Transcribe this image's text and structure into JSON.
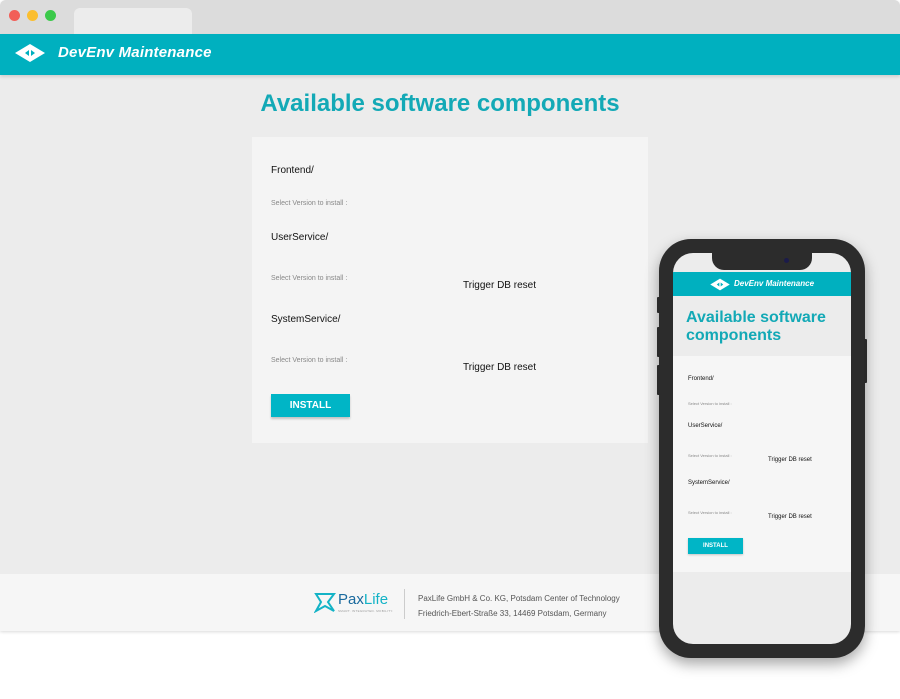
{
  "browser": {
    "tab_title": ""
  },
  "app": {
    "title": "DevEnv Maintenance",
    "logo_icon": "diamond-arrows-icon"
  },
  "page": {
    "heading": "Available software components"
  },
  "components": [
    {
      "name": "Frontend/",
      "hint": "Select Version to install :"
    },
    {
      "name": "UserService/",
      "hint": "Select Version to install :",
      "reset_label": "Trigger DB reset"
    },
    {
      "name": "SystemService/",
      "hint": "Select Version to install :",
      "reset_label": "Trigger DB reset"
    }
  ],
  "actions": {
    "install_label": "INSTALL"
  },
  "footer": {
    "brand_part1": "Pax",
    "brand_part2": "Life",
    "tagline": "SMART. INTEGRATED. MOBILITY.",
    "address_line1": "PaxLife GmbH & Co. KG, Potsdam Center of Technology",
    "address_line2": "Friedrich-Ebert-Straße 33, 14469 Potsdam, Germany"
  },
  "colors": {
    "accent": "#00b0bf",
    "heading": "#13a9b6",
    "background": "#ececec"
  }
}
